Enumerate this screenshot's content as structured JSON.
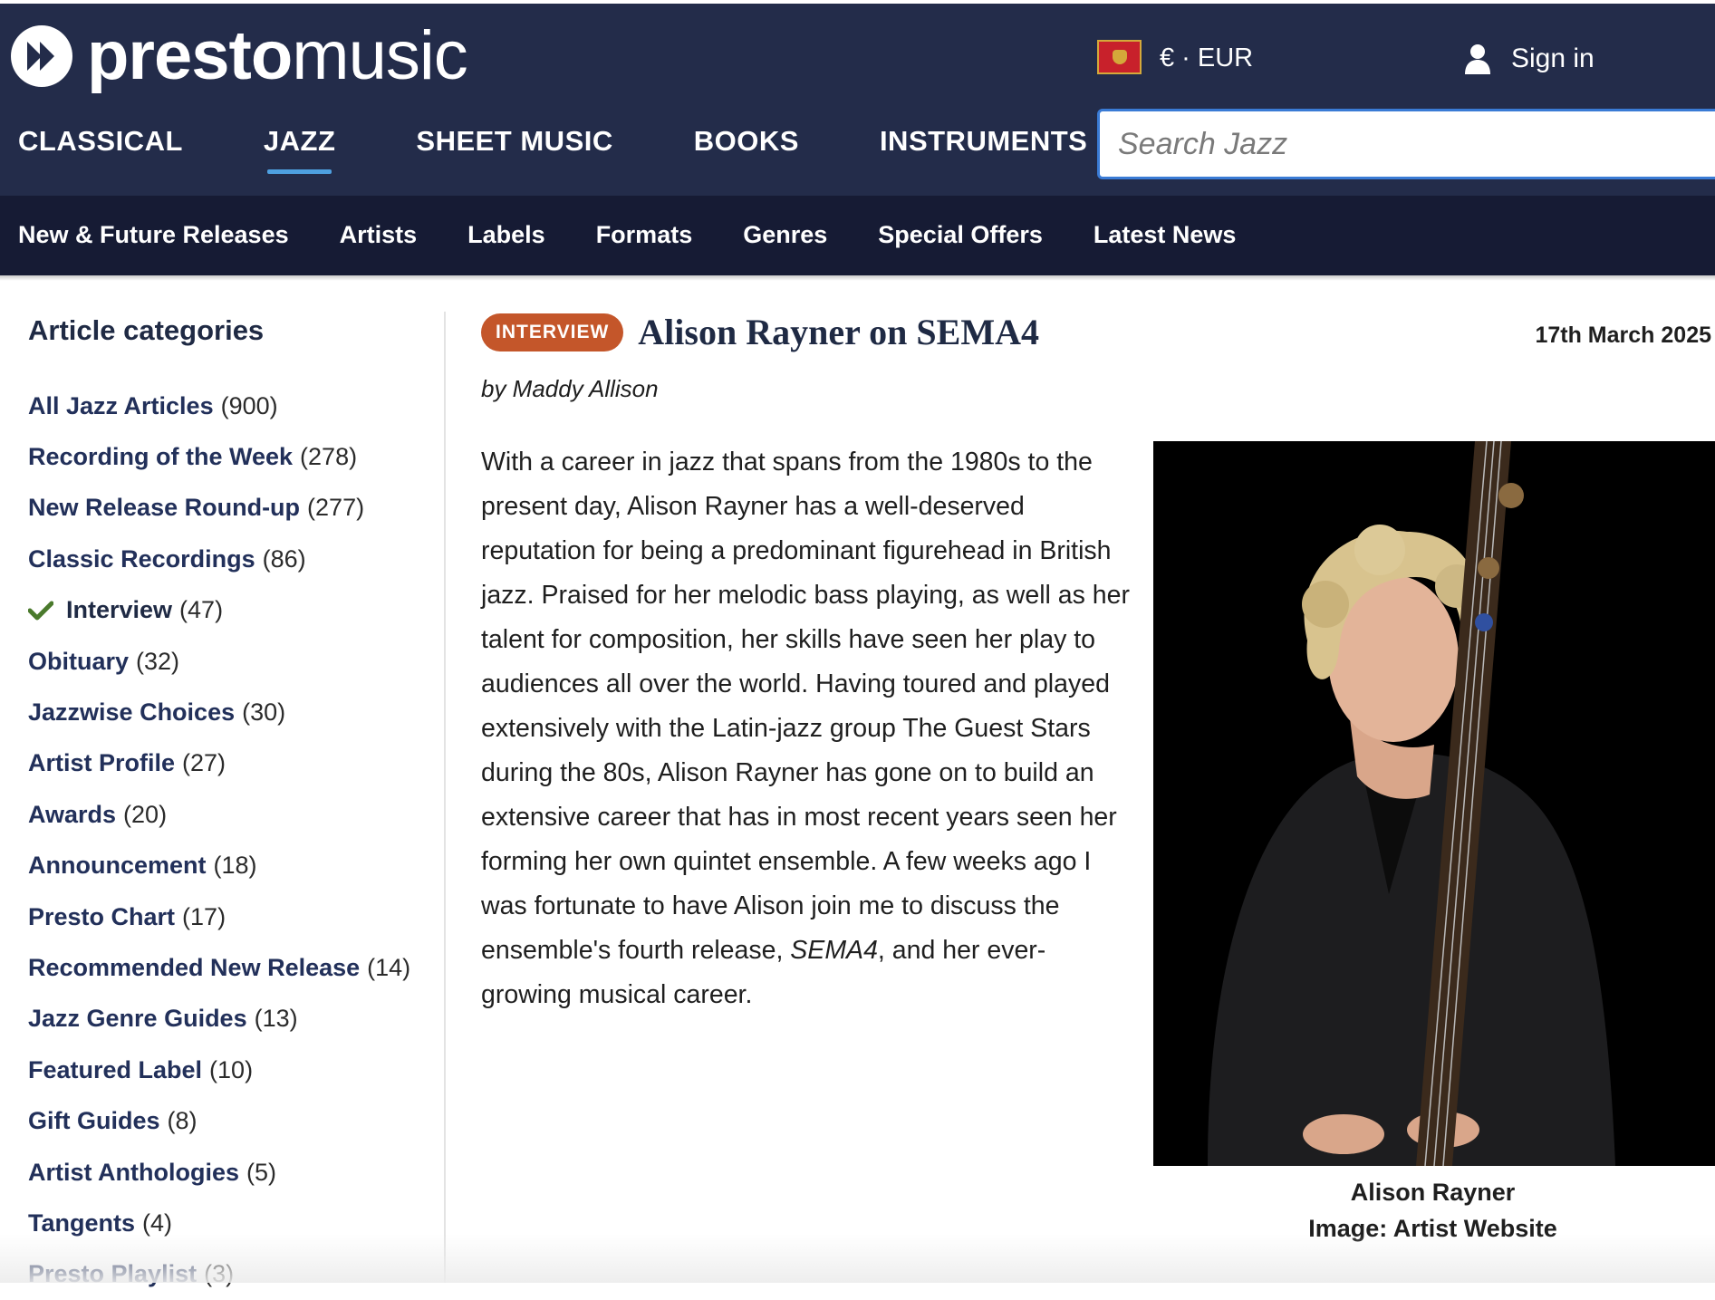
{
  "brand": {
    "name_bold": "presto",
    "name_light": "music"
  },
  "header": {
    "currency": "€ · EUR",
    "sign_in": "Sign in",
    "flag_icon": "montenegro-flag-icon",
    "search_placeholder": "Search Jazz"
  },
  "main_nav": [
    {
      "label": "CLASSICAL",
      "active": false
    },
    {
      "label": "JAZZ",
      "active": true
    },
    {
      "label": "SHEET MUSIC",
      "active": false
    },
    {
      "label": "BOOKS",
      "active": false
    },
    {
      "label": "INSTRUMENTS",
      "active": false
    }
  ],
  "sub_nav": [
    "New & Future Releases",
    "Artists",
    "Labels",
    "Formats",
    "Genres",
    "Special Offers",
    "Latest News"
  ],
  "sidebar": {
    "title": "Article categories",
    "categories": [
      {
        "name": "All Jazz Articles",
        "count": "(900)"
      },
      {
        "name": "Recording of the Week",
        "count": "(278)"
      },
      {
        "name": "New Release Round-up",
        "count": "(277)"
      },
      {
        "name": "Classic Recordings",
        "count": "(86)"
      },
      {
        "name": "Interview",
        "count": "(47)",
        "active": true
      },
      {
        "name": "Obituary",
        "count": "(32)"
      },
      {
        "name": "Jazzwise Choices",
        "count": "(30)"
      },
      {
        "name": "Artist Profile",
        "count": "(27)"
      },
      {
        "name": "Awards",
        "count": "(20)"
      },
      {
        "name": "Announcement",
        "count": "(18)"
      },
      {
        "name": "Presto Chart",
        "count": "(17)"
      },
      {
        "name": "Recommended New Release",
        "count": "(14)"
      },
      {
        "name": "Jazz Genre Guides",
        "count": "(13)"
      },
      {
        "name": "Featured Label",
        "count": "(10)"
      },
      {
        "name": "Gift Guides",
        "count": "(8)"
      },
      {
        "name": "Artist Anthologies",
        "count": "(5)"
      },
      {
        "name": "Tangents",
        "count": "(4)"
      },
      {
        "name": "Presto Playlist",
        "count": "(3)"
      }
    ]
  },
  "article": {
    "badge": "INTERVIEW",
    "title": "Alison Rayner on SEMA4",
    "date": "17th March 2025",
    "byline": "by Maddy Allison",
    "body_before_italic": "With a career in jazz that spans from the 1980s to the present day, Alison Rayner has a well-deserved reputation for being a predominant figurehead in British jazz. Praised for her melodic bass playing, as well as her talent for composition, her skills have seen her play to audiences all over the world. Having toured and played extensively with the Latin-jazz group The Guest Stars during the 80s, Alison Rayner has gone on to build an extensive career that has in most recent years seen her forming her own quintet ensemble. A few weeks ago I was fortunate to have Alison join me to discuss the ensemble's fourth release, ",
    "body_italic": "SEMA4",
    "body_after_italic": ", and her ever-growing musical career.",
    "image_caption_line1": "Alison Rayner",
    "image_caption_line2": "Image: Artist Website"
  },
  "colors": {
    "header_bg": "#232c4a",
    "subnav_bg": "#161b34",
    "badge": "#c4562a",
    "active_underline": "#4ea0e0",
    "check": "#4a7a2c"
  }
}
